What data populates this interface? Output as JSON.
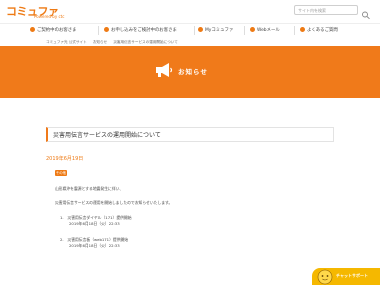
{
  "header": {
    "logo": "コミュファ",
    "logo_sub": "Powered by ctc",
    "search_placeholder": "サイト内を検索"
  },
  "nav": {
    "items": [
      {
        "label": "ご契約中のお客さま"
      },
      {
        "label": "お申し込みをご検討中のお客さま"
      },
      {
        "label": "Myコミュファ"
      },
      {
        "label": "Webメール"
      },
      {
        "label": "よくあるご質問"
      }
    ]
  },
  "breadcrumb": [
    "コミュファ光 公式サイト",
    "お知らせ",
    "災害用伝言サービスの運用開始について"
  ],
  "banner": {
    "title": "お知らせ"
  },
  "article": {
    "title": "災害用伝言サービスの運用開始について",
    "date": "2019年6月19日",
    "tag": "その他",
    "lines": [
      "山形県沖を震源とする地震発生に伴い、",
      "災害用伝言サービスの運用を開始しましたのでお知らせいたします。",
      "1.　災害用伝言ダイヤル（171）提供開始",
      "2019年6月18日（火）22:33",
      "2.　災害用伝言板（web171）提供開始",
      "2019年6月18日（火）22:33"
    ]
  },
  "chat": {
    "label": "チャットサポート"
  },
  "colors": {
    "brand": "#f07a1a",
    "chat": "#f5b800"
  }
}
